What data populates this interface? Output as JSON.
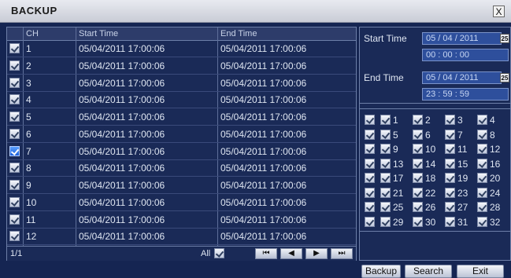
{
  "window": {
    "title": "BACKUP",
    "close_glyph": "X"
  },
  "table": {
    "headers": {
      "ch": "CH",
      "start": "Start Time",
      "end": "End Time"
    },
    "rows": [
      {
        "ch": "1",
        "start": "05/04/2011 17:00:06",
        "end": "05/04/2011 17:00:06",
        "selected": false
      },
      {
        "ch": "2",
        "start": "05/04/2011 17:00:06",
        "end": "05/04/2011 17:00:06",
        "selected": false
      },
      {
        "ch": "3",
        "start": "05/04/2011 17:00:06",
        "end": "05/04/2011 17:00:06",
        "selected": false
      },
      {
        "ch": "4",
        "start": "05/04/2011 17:00:06",
        "end": "05/04/2011 17:00:06",
        "selected": false
      },
      {
        "ch": "5",
        "start": "05/04/2011 17:00:06",
        "end": "05/04/2011 17:00:06",
        "selected": false
      },
      {
        "ch": "6",
        "start": "05/04/2011 17:00:06",
        "end": "05/04/2011 17:00:06",
        "selected": false
      },
      {
        "ch": "7",
        "start": "05/04/2011 17:00:06",
        "end": "05/04/2011 17:00:06",
        "selected": true
      },
      {
        "ch": "8",
        "start": "05/04/2011 17:00:06",
        "end": "05/04/2011 17:00:06",
        "selected": false
      },
      {
        "ch": "9",
        "start": "05/04/2011 17:00:06",
        "end": "05/04/2011 17:00:06",
        "selected": false
      },
      {
        "ch": "10",
        "start": "05/04/2011 17:00:06",
        "end": "05/04/2011 17:00:06",
        "selected": false
      },
      {
        "ch": "11",
        "start": "05/04/2011 17:00:06",
        "end": "05/04/2011 17:00:06",
        "selected": false
      },
      {
        "ch": "12",
        "start": "05/04/2011 17:00:06",
        "end": "05/04/2011 17:00:06",
        "selected": false
      }
    ],
    "page": "1/1",
    "all_label": "All"
  },
  "time": {
    "start_label": "Start Time",
    "start_date": "05 / 04 / 2011",
    "start_time": "00  :  00  :  00",
    "end_label": "End Time",
    "end_date": "05 / 04 / 2011",
    "end_time": "23  :  59  :  59",
    "calendar_glyph": "25"
  },
  "channels": [
    "1",
    "2",
    "3",
    "4",
    "5",
    "6",
    "7",
    "8",
    "9",
    "10",
    "11",
    "12",
    "13",
    "14",
    "15",
    "16",
    "17",
    "18",
    "19",
    "20",
    "21",
    "22",
    "23",
    "24",
    "25",
    "26",
    "27",
    "28",
    "29",
    "30",
    "31",
    "32"
  ],
  "buttons": {
    "backup": "Backup",
    "search": "Search",
    "exit": "Exit"
  },
  "colors": {
    "accent": "#2e4f9c",
    "background": "#152552",
    "selected_check": "#1d5fd8"
  },
  "icons": {
    "nav": [
      "first-page-icon",
      "prev-page-icon",
      "next-page-icon",
      "last-page-icon"
    ]
  }
}
